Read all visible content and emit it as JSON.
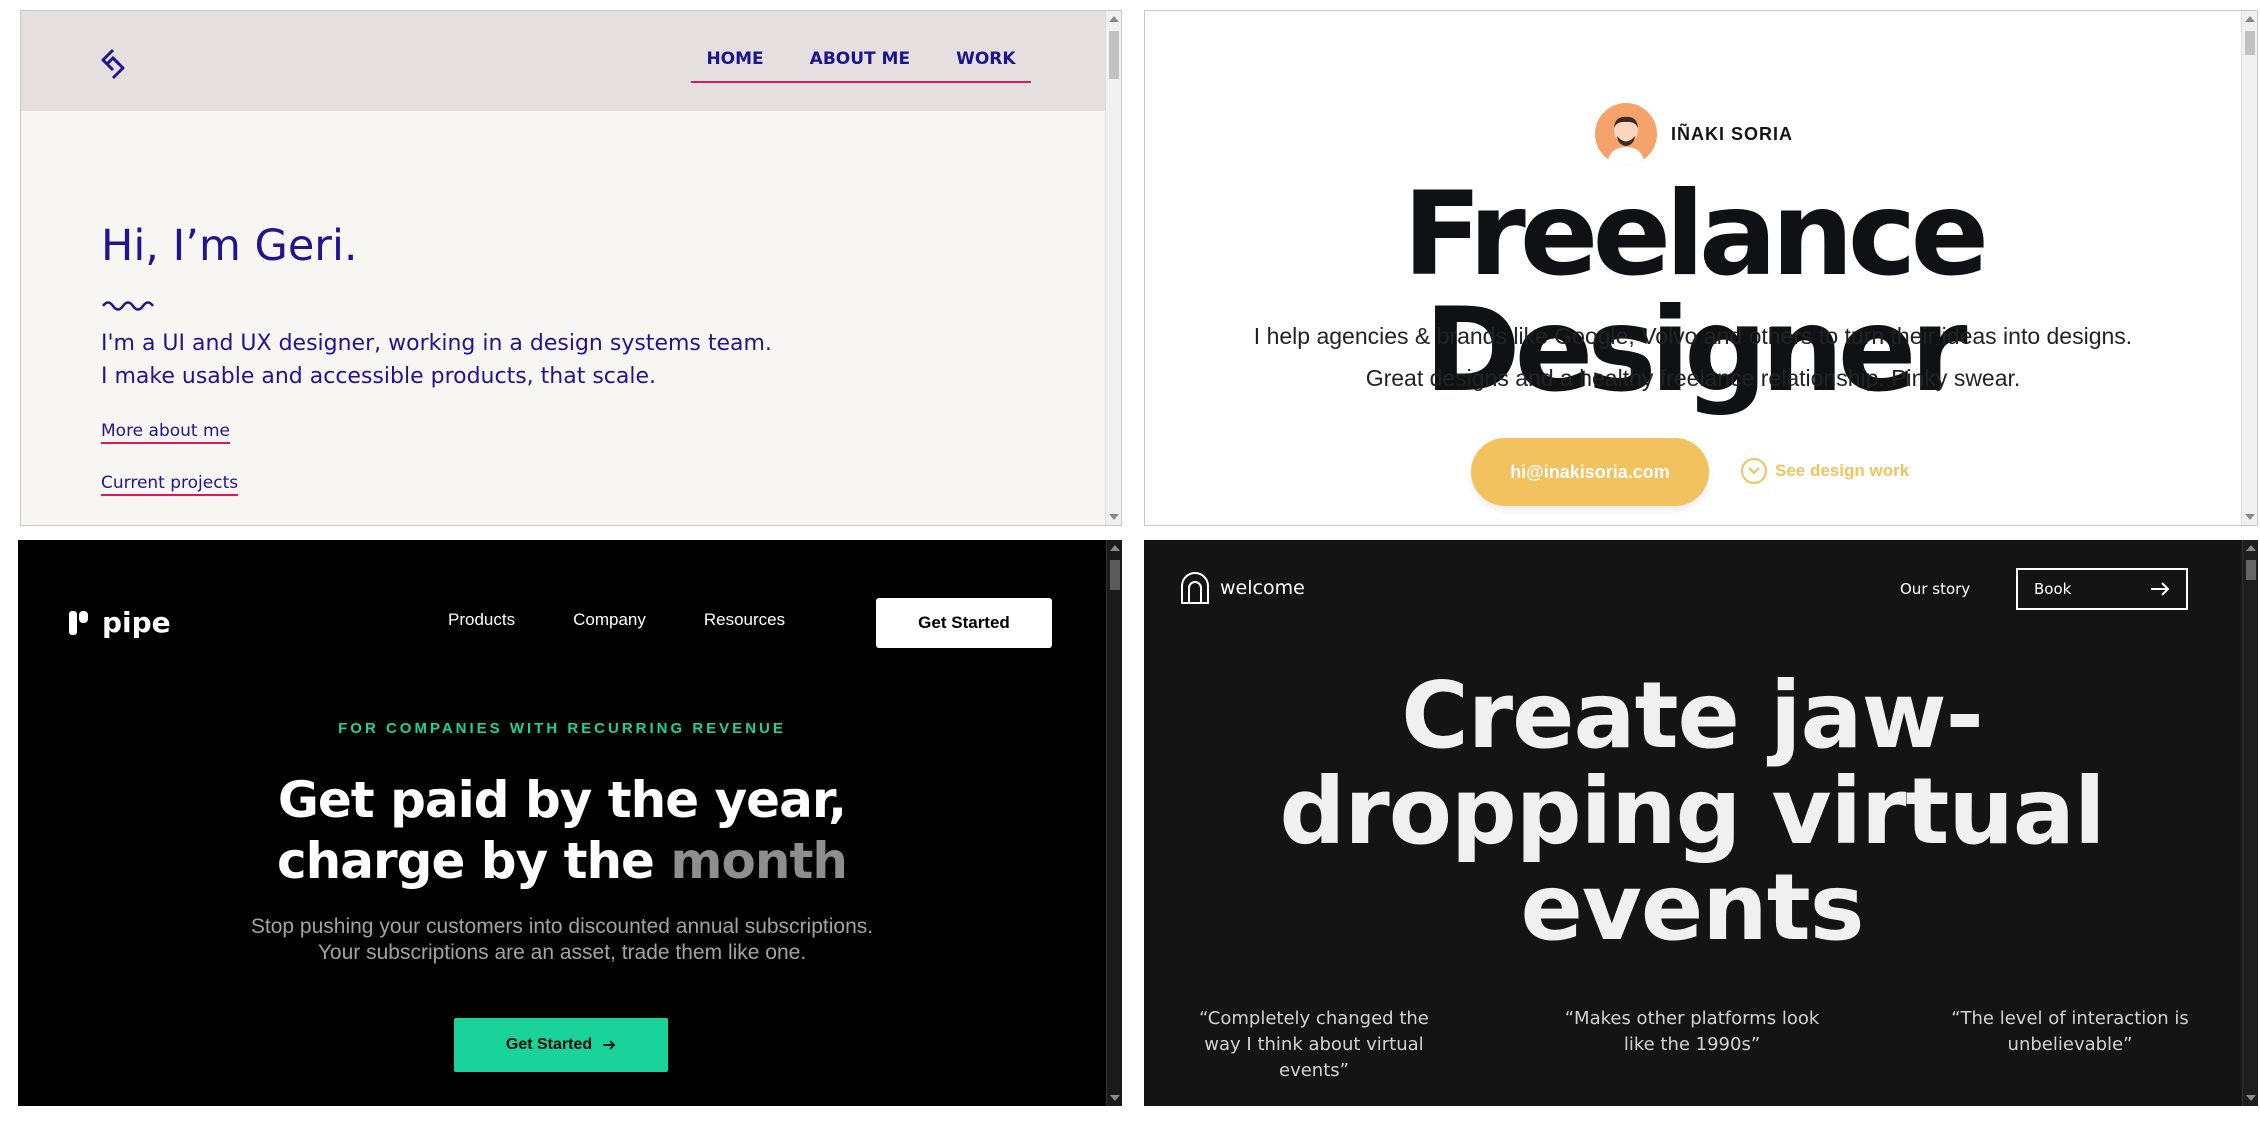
{
  "geri": {
    "nav": [
      "HOME",
      "ABOUT ME",
      "WORK"
    ],
    "headline": "Hi, I’m Geri.",
    "intro_line1": "I'm a UI and UX designer, working in a design systems team.",
    "intro_line2": "I make usable and accessible products, that scale.",
    "link_about": "More about me",
    "link_projects": "Current projects",
    "colors": {
      "text": "#22148f",
      "accent": "#d81b60",
      "header_bg": "#e6dfe0",
      "page_bg": "#f8f6f2"
    }
  },
  "inaki": {
    "name": "IÑAKI SORIA",
    "headline": "Freelance Designer",
    "lead_line1": "I help agencies & brands like Google, Volvo and others to turn their ideas into designs.",
    "lead_line2": "Great designs and a healthy freelance relationship. Pinky swear.",
    "email_button": "hi@inakisoria.com",
    "secondary_link": "See design work",
    "colors": {
      "accent": "#f2c25e",
      "avatar_bg": "#f6a36b"
    }
  },
  "pipe": {
    "brand": "pipe",
    "nav": [
      "Products",
      "Company",
      "Resources"
    ],
    "cta_top": "Get Started",
    "eyebrow": "FOR COMPANIES WITH RECURRING REVENUE",
    "headline_line1": "Get paid by the year,",
    "headline_line2a": "charge by the",
    "headline_line2b": "month",
    "sub_line1": "Stop pushing your customers into discounted annual subscriptions.",
    "sub_line2": "Your subscriptions are an asset, trade them like one.",
    "cta_main": "Get Started",
    "colors": {
      "accent": "#19d39a",
      "muted": "#8e8e8e"
    }
  },
  "welcome": {
    "brand": "welcome",
    "nav_story": "Our story",
    "book": "Book",
    "headline_line1": "Create jaw-",
    "headline_line2": "dropping virtual",
    "headline_line3": "events",
    "quotes": [
      "“Completely changed the way I think about virtual events”",
      "“Makes other platforms look like the 1990s”",
      "“The level of interaction is unbelievable”"
    ],
    "icons": [
      "arch-logo-icon",
      "arrow-right-icon"
    ]
  }
}
